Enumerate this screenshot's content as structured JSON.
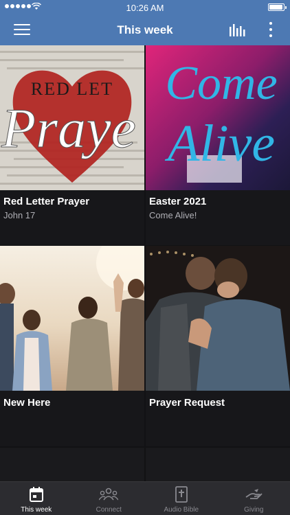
{
  "status": {
    "time": "10:26 AM"
  },
  "header": {
    "title": "This week"
  },
  "cards": [
    {
      "title": "Red Letter Prayer",
      "subtitle": "John 17",
      "artwork_text_top": "RED LET",
      "artwork_text_big": "Praye"
    },
    {
      "title": "Easter 2021",
      "subtitle": "Come Alive!",
      "artwork_text_1": "Come",
      "artwork_text_2": "Alive"
    },
    {
      "title": "New Here",
      "subtitle": ""
    },
    {
      "title": "Prayer Request",
      "subtitle": ""
    }
  ],
  "tabs": [
    {
      "label": "This week",
      "icon": "calendar-icon",
      "active": true
    },
    {
      "label": "Connect",
      "icon": "group-icon",
      "active": false
    },
    {
      "label": "Audio Bible",
      "icon": "bible-icon",
      "active": false
    },
    {
      "label": "Giving",
      "icon": "giving-hand-icon",
      "active": false
    }
  ],
  "colors": {
    "header": "#4d79b3",
    "background": "#121214",
    "tab_bar": "#2c2c30"
  }
}
